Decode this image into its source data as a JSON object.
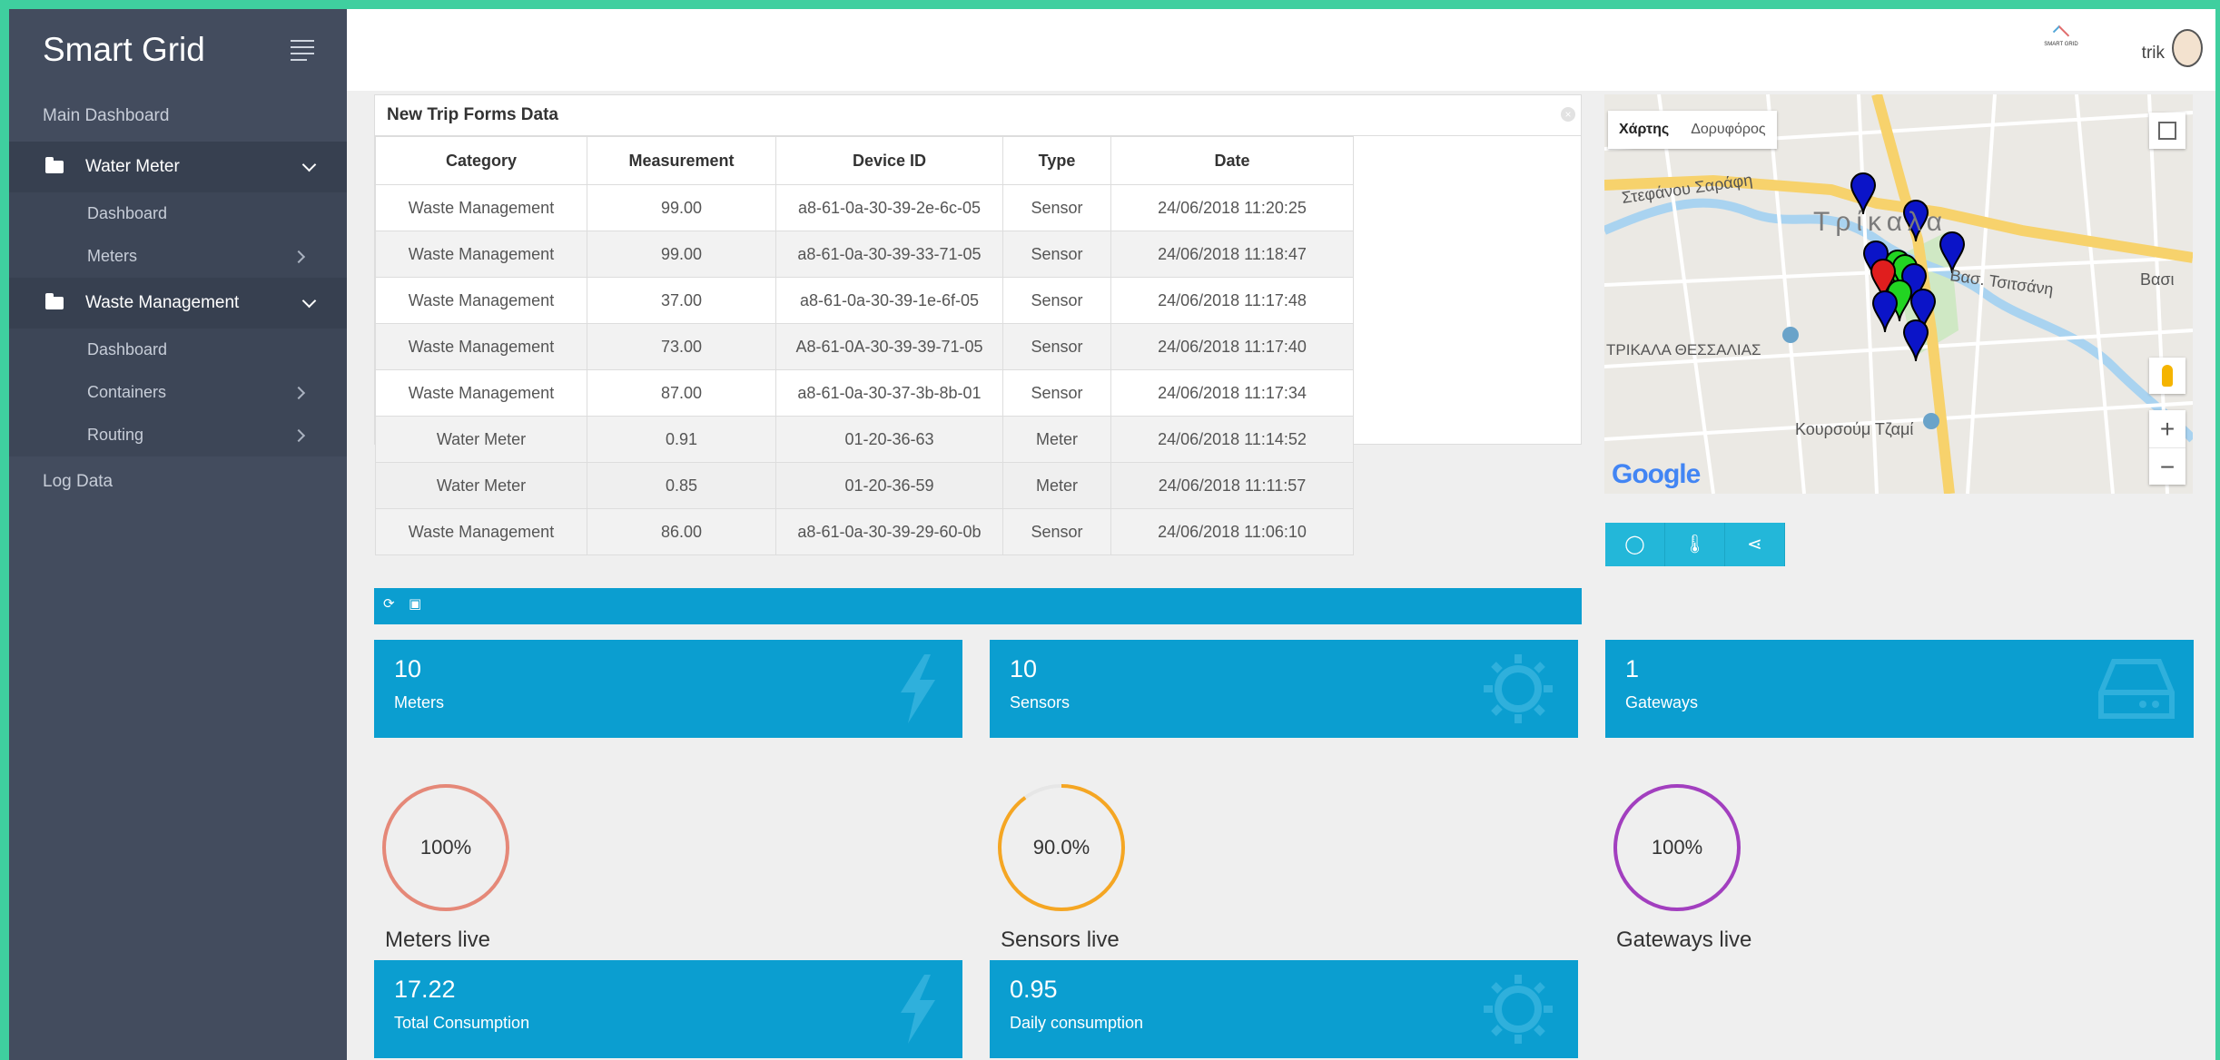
{
  "sidebar": {
    "brand": "Smart Grid",
    "main_dashboard": "Main Dashboard",
    "groups": [
      {
        "label": "Water Meter",
        "items": [
          {
            "label": "Dashboard"
          },
          {
            "label": "Meters"
          }
        ]
      },
      {
        "label": "Waste Management",
        "items": [
          {
            "label": "Dashboard"
          },
          {
            "label": "Containers"
          },
          {
            "label": "Routing"
          }
        ]
      }
    ],
    "log_data": "Log Data"
  },
  "header": {
    "logo_text": "SMART GRID",
    "user_name": "trik"
  },
  "table": {
    "title": "New Trip Forms Data",
    "columns": [
      "Category",
      "Measurement",
      "Device ID",
      "Type",
      "Date"
    ],
    "rows": [
      [
        "Waste Management",
        "99.00",
        "a8-61-0a-30-39-2e-6c-05",
        "Sensor",
        "24/06/2018 11:20:25"
      ],
      [
        "Waste Management",
        "99.00",
        "a8-61-0a-30-39-33-71-05",
        "Sensor",
        "24/06/2018 11:18:47"
      ],
      [
        "Waste Management",
        "37.00",
        "a8-61-0a-30-39-1e-6f-05",
        "Sensor",
        "24/06/2018 11:17:48"
      ],
      [
        "Waste Management",
        "73.00",
        "A8-61-0A-30-39-39-71-05",
        "Sensor",
        "24/06/2018 11:17:40"
      ],
      [
        "Waste Management",
        "87.00",
        "a8-61-0a-30-37-3b-8b-01",
        "Sensor",
        "24/06/2018 11:17:34"
      ],
      [
        "Water Meter",
        "0.91",
        "01-20-36-63",
        "Meter",
        "24/06/2018 11:14:52"
      ],
      [
        "Water Meter",
        "0.85",
        "01-20-36-59",
        "Meter",
        "24/06/2018 11:11:57"
      ],
      [
        "Waste Management",
        "86.00",
        "a8-61-0a-30-39-29-60-0b",
        "Sensor",
        "24/06/2018 11:06:10"
      ]
    ]
  },
  "map": {
    "tab_map": "Χάρτης",
    "tab_satellite": "Δορυφόρος",
    "labels": {
      "street1": "Στεφάνου Σαράφη",
      "city": "Τρίκαλα",
      "street2": "Βασ. Τσιτσάνη",
      "region": "ΤΡΙΚΑΛΑ ΘΕΣΣΑΛΙΑΣ",
      "poi": "Κουρσούμ Τζαμί",
      "vasi": "Βασι"
    },
    "google": "Google",
    "zoom_in": "+",
    "zoom_out": "−",
    "marker_colors": {
      "blue": "#0b14c8",
      "green": "#22d422",
      "red": "#e01e1e"
    }
  },
  "cards": {
    "meters": {
      "value": "10",
      "label": "Meters"
    },
    "sensors": {
      "value": "10",
      "label": "Sensors"
    },
    "gateways": {
      "value": "1",
      "label": "Gateways"
    },
    "total_consumption": {
      "value": "17.22",
      "label": "Total Consumption"
    },
    "daily_consumption": {
      "value": "0.95",
      "label": "Daily consumption"
    }
  },
  "gauges": {
    "meters": {
      "text": "100%",
      "fraction": 1.0,
      "color": "#e58878",
      "label": "Meters live"
    },
    "sensors": {
      "text": "90.0%",
      "fraction": 0.9,
      "color": "#f5a623",
      "label": "Sensors live"
    },
    "gateways": {
      "text": "100%",
      "fraction": 1.0,
      "color": "#a23fbf",
      "label": "Gateways live"
    }
  },
  "colors": {
    "sidebar": "#434c5e",
    "accent": "#0b9ed0",
    "map_controls": "#23b7d9",
    "frame": "#3fcf9f"
  }
}
